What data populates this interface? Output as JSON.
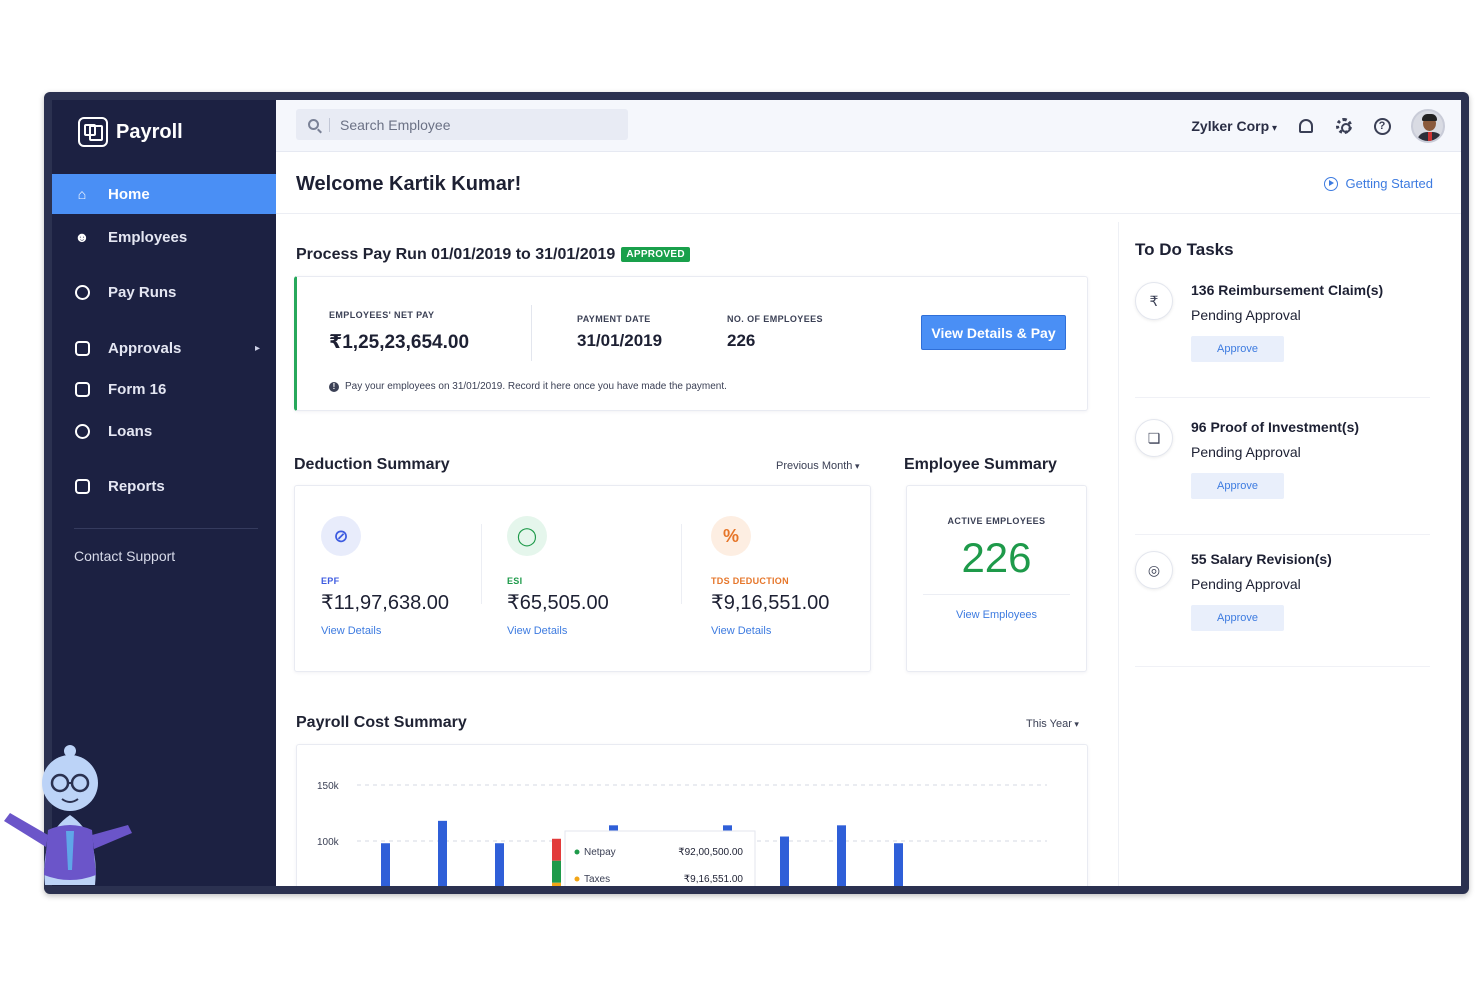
{
  "app": {
    "name": "Payroll"
  },
  "sidebar": {
    "items": [
      {
        "label": "Home",
        "icon": "home-icon",
        "active": true
      },
      {
        "label": "Employees",
        "icon": "user-icon"
      },
      {
        "label": "Pay Runs",
        "icon": "clock-icon"
      },
      {
        "label": "Approvals",
        "icon": "check-icon"
      },
      {
        "label": "Form 16",
        "icon": "document-icon"
      },
      {
        "label": "Loans",
        "icon": "coin-icon"
      },
      {
        "label": "Reports",
        "icon": "chart-icon"
      }
    ],
    "support_label": "Contact Support"
  },
  "topbar": {
    "search_placeholder": "Search Employee",
    "org_name": "Zylker Corp"
  },
  "welcome": {
    "title": "Welcome Kartik Kumar!",
    "getting_started": "Getting Started"
  },
  "pay_run": {
    "title": "Process Pay Run 01/01/2019 to 31/01/2019",
    "status": "APPROVED",
    "net_pay_label": "EMPLOYEES' NET PAY",
    "net_pay": "₹1,25,23,654.00",
    "payment_date_label": "PAYMENT DATE",
    "payment_date": "31/01/2019",
    "employees_label": "NO. OF EMPLOYEES",
    "employees": "226",
    "button": "View Details & Pay",
    "note": "Pay your employees on 31/01/2019. Record it here once you have made the payment."
  },
  "deduction": {
    "title": "Deduction Summary",
    "period": "Previous Month",
    "items": [
      {
        "label": "EPF",
        "value": "₹11,97,638.00",
        "link": "View Details",
        "color": "#3d5be0",
        "bg": "#e8ecfb",
        "icon": "epf-icon"
      },
      {
        "label": "ESI",
        "value": "₹65,505.00",
        "link": "View Details",
        "color": "#1e9a4a",
        "bg": "#e5f6ec",
        "icon": "shield-icon"
      },
      {
        "label": "TDS DEDUCTION",
        "value": "₹9,16,551.00",
        "link": "View Details",
        "color": "#e6762a",
        "bg": "#fdeee2",
        "icon": "percent-icon"
      }
    ]
  },
  "employee_summary": {
    "title": "Employee Summary",
    "label": "ACTIVE EMPLOYEES",
    "count": "226",
    "link": "View Employees"
  },
  "payroll_cost": {
    "title": "Payroll Cost Summary",
    "period": "This Year",
    "tooltip": [
      {
        "label": "Netpay",
        "value": "₹92,00,500.00",
        "color": "#1e9a4a"
      },
      {
        "label": "Taxes",
        "value": "₹9,16,551.00",
        "color": "#f2a516"
      }
    ]
  },
  "chart_data": {
    "type": "bar",
    "title": "Payroll Cost Summary",
    "y_ticks": [
      "150k",
      "100k"
    ],
    "ylim": [
      0,
      160000
    ],
    "values": [
      98000,
      118000,
      98000,
      102000,
      114000,
      98000,
      114000,
      104000,
      114000,
      98000
    ],
    "highlight_index": 3,
    "stack_colors": [
      "#e23b3b",
      "#1e9a4a",
      "#f2a516"
    ],
    "bar_color": "#2f5fd8"
  },
  "todo": {
    "title": "To Do Tasks",
    "items": [
      {
        "count_text": "136 Reimbursement Claim(s)",
        "status": "Pending Approval",
        "button": "Approve",
        "icon": "rupee-doc-icon"
      },
      {
        "count_text": "96 Proof of Investment(s)",
        "status": "Pending Approval",
        "button": "Approve",
        "icon": "copy-doc-icon"
      },
      {
        "count_text": "55 Salary Revision(s)",
        "status": "Pending Approval",
        "button": "Approve",
        "icon": "coins-icon"
      }
    ]
  }
}
